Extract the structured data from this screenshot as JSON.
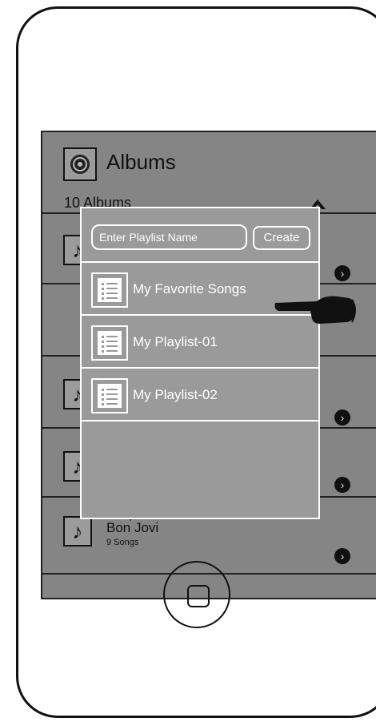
{
  "header": {
    "title": "Albums",
    "count": "10 Albums"
  },
  "list": {
    "last_item": {
      "title": "Keep The Faith",
      "artist": "Bon Jovi",
      "songs": "9 Songs"
    }
  },
  "popup": {
    "input_placeholder": "Enter Playlist Name",
    "create_label": "Create",
    "playlists": [
      {
        "label": "My Favorite Songs"
      },
      {
        "label": "My Playlist-01"
      },
      {
        "label": "My Playlist-02"
      }
    ]
  },
  "colors": {
    "screen": "#858585",
    "popup": "#9a9a9a",
    "line": "#222222"
  }
}
